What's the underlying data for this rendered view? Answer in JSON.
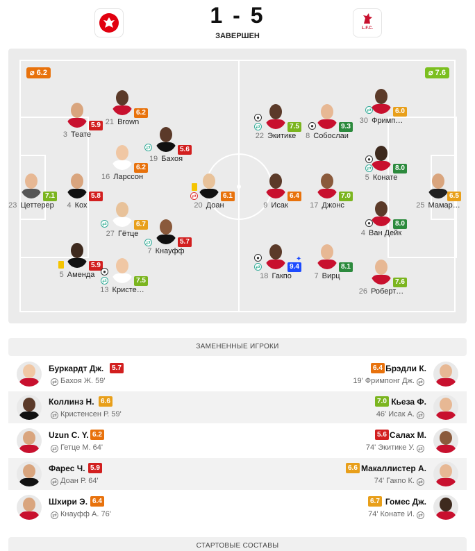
{
  "match": {
    "score": "1 - 5",
    "status": "ЗАВЕРШЕН",
    "home_crest": "eintracht-frankfurt-crest",
    "away_crest": "liverpool-crest",
    "away_crest_text": "L.F.C."
  },
  "lineup": {
    "home_avg": "⌀ 6.2",
    "away_avg": "⌀ 7.6",
    "home": [
      {
        "num": "21",
        "name": "Brown",
        "rating": "6.2"
      },
      {
        "num": "3",
        "name": "Теате",
        "rating": "5.9"
      },
      {
        "num": "19",
        "name": "Бахоя",
        "rating": "5.6"
      },
      {
        "num": "16",
        "name": "Ларссон",
        "rating": "6.2"
      },
      {
        "num": "23",
        "name": "Цеттерер",
        "rating": "7.1"
      },
      {
        "num": "4",
        "name": "Кох",
        "rating": "5.8"
      },
      {
        "num": "20",
        "name": "Доан",
        "rating": "6.1"
      },
      {
        "num": "27",
        "name": "Гётце",
        "rating": "6.7"
      },
      {
        "num": "7",
        "name": "Кнауфф",
        "rating": "5.7"
      },
      {
        "num": "5",
        "name": "Аменда",
        "rating": "5.9"
      },
      {
        "num": "13",
        "name": "Кристе…",
        "rating": "7.5"
      }
    ],
    "away": [
      {
        "num": "30",
        "name": "Фримп…",
        "rating": "6.0"
      },
      {
        "num": "22",
        "name": "Экитике",
        "rating": "7.5"
      },
      {
        "num": "8",
        "name": "Собослаи",
        "rating": "9.3"
      },
      {
        "num": "5",
        "name": "Конате",
        "rating": "8.0"
      },
      {
        "num": "9",
        "name": "Исак",
        "rating": "6.4"
      },
      {
        "num": "17",
        "name": "Джонс",
        "rating": "7.0"
      },
      {
        "num": "25",
        "name": "Мамар…",
        "rating": "6.5"
      },
      {
        "num": "4",
        "name": "Ван Дейк",
        "rating": "8.0"
      },
      {
        "num": "18",
        "name": "Гакпо",
        "rating": "9.4"
      },
      {
        "num": "7",
        "name": "Вирц",
        "rating": "8.1"
      },
      {
        "num": "26",
        "name": "Роберт…",
        "rating": "7.6"
      }
    ]
  },
  "subs": {
    "title": "ЗАМЕНЕННЫЕ ИГРОКИ",
    "rows": [
      {
        "home_name": "Буркардт Дж.",
        "home_rating": "5.7",
        "home_out": "Бахоя Ж. 59'",
        "away_name": "Брэдли К.",
        "away_rating": "6.4",
        "away_out": "19' Фримпонг Дж."
      },
      {
        "home_name": "Коллинз Н.",
        "home_rating": "6.6",
        "home_out": "Кристенсен Р. 59'",
        "away_name": "Кьеза Ф.",
        "away_rating": "7.0",
        "away_out": "46' Исак А."
      },
      {
        "home_name": "Uzun C. Y.",
        "home_rating": "6.2",
        "home_out": "Гетце М. 64'",
        "away_name": "Салах М.",
        "away_rating": "5.6",
        "away_out": "74' Экитике У."
      },
      {
        "home_name": "Фарес Ч.",
        "home_rating": "5.9",
        "home_out": "Доан Р. 64'",
        "away_name": "Макаллистер А.",
        "away_rating": "6.6",
        "away_out": "74' Гакпо К."
      },
      {
        "home_name": "Шхири Э.",
        "home_rating": "6.4",
        "home_out": "Кнауфф А. 76'",
        "away_name": "Гомес Дж.",
        "away_rating": "6.7",
        "away_out": "74' Конате И."
      }
    ]
  },
  "lineups_title": "СТАРТОВЫЕ СОСТАВЫ",
  "colors": {
    "rating_red": "#d21f1f",
    "rating_orange": "#e8720c",
    "rating_amber": "#e89f1a",
    "rating_lightgreen": "#7bb51f",
    "rating_green": "#2c8a3d",
    "rating_blue": "#1d4bff",
    "pitch": "#ebebeb"
  }
}
